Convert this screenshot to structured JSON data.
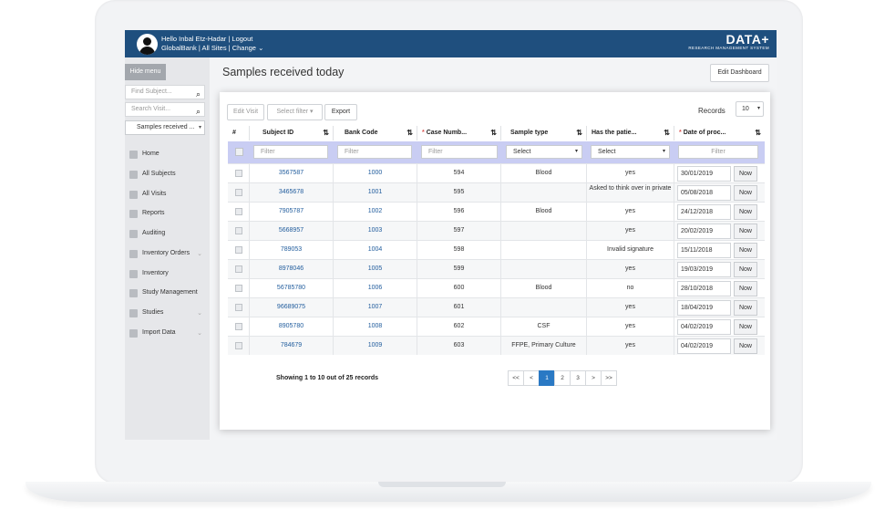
{
  "header": {
    "greeting": "Hello Inbal Etz-Hadar",
    "logout": "Logout",
    "org": "GlobalBank",
    "sites": "All Sites",
    "change": "Change",
    "brand_name": "DATA+",
    "brand_sub": "RESEARCH MANAGEMENT SYSTEM"
  },
  "sidebar": {
    "hide_menu": "Hide menu",
    "find_subject_placeholder": "Find Subject...",
    "search_visit_placeholder": "Search Visit...",
    "view_select": "Samples received ...",
    "items": [
      {
        "label": "Home",
        "icon": "home-icon"
      },
      {
        "label": "All Subjects",
        "icon": "users-icon"
      },
      {
        "label": "All Visits",
        "icon": "id-card-icon"
      },
      {
        "label": "Reports",
        "icon": "reports-icon"
      },
      {
        "label": "Auditing",
        "icon": "auditing-icon"
      },
      {
        "label": "Inventory Orders",
        "icon": "inventory-orders-icon",
        "expandable": true
      },
      {
        "label": "Inventory",
        "icon": "inventory-icon"
      },
      {
        "label": "Study Management",
        "icon": "study-management-icon"
      },
      {
        "label": "Studies",
        "icon": "studies-icon",
        "expandable": true
      },
      {
        "label": "Import Data",
        "icon": "import-icon",
        "expandable": true
      }
    ]
  },
  "main": {
    "title": "Samples received today",
    "edit_dashboard": "Edit Dashboard"
  },
  "toolbar": {
    "edit_visit": "Edit Visit",
    "select_filter": "Select filter",
    "export": "Export",
    "records_label": "Records",
    "records_value": "10"
  },
  "table": {
    "columns": [
      "#",
      "Subject ID",
      "Bank Code",
      "Case Numb...",
      "Sample type",
      "Has the patie...",
      "Date of proc..."
    ],
    "required_marker": "*",
    "filters": {
      "subject_id": "Filter",
      "bank_code": "Filter",
      "case_number": "Filter",
      "sample_type": "Select",
      "has_patient": "Select",
      "date": "Filter"
    },
    "now_label": "Now",
    "rows": [
      {
        "subject_id": "3567587",
        "bank_code": "1000",
        "case_number": "594",
        "sample_type": "Blood",
        "has_patient": "yes",
        "date": "30/01/2019"
      },
      {
        "subject_id": "3465678",
        "bank_code": "1001",
        "case_number": "595",
        "sample_type": "",
        "has_patient": "Asked to think over in private",
        "date": "05/08/2018"
      },
      {
        "subject_id": "7905787",
        "bank_code": "1002",
        "case_number": "596",
        "sample_type": "Blood",
        "has_patient": "yes",
        "date": "24/12/2018"
      },
      {
        "subject_id": "5668957",
        "bank_code": "1003",
        "case_number": "597",
        "sample_type": "",
        "has_patient": "yes",
        "date": "20/02/2019"
      },
      {
        "subject_id": "789053",
        "bank_code": "1004",
        "case_number": "598",
        "sample_type": "",
        "has_patient": "Invalid signature",
        "date": "15/11/2018"
      },
      {
        "subject_id": "8978046",
        "bank_code": "1005",
        "case_number": "599",
        "sample_type": "",
        "has_patient": "yes",
        "date": "19/03/2019"
      },
      {
        "subject_id": "56785780",
        "bank_code": "1006",
        "case_number": "600",
        "sample_type": "Blood",
        "has_patient": "no",
        "date": "28/10/2018"
      },
      {
        "subject_id": "96689075",
        "bank_code": "1007",
        "case_number": "601",
        "sample_type": "",
        "has_patient": "yes",
        "date": "18/04/2019"
      },
      {
        "subject_id": "8905780",
        "bank_code": "1008",
        "case_number": "602",
        "sample_type": "CSF",
        "has_patient": "yes",
        "date": "04/02/2019"
      },
      {
        "subject_id": "784679",
        "bank_code": "1009",
        "case_number": "603",
        "sample_type": "FFPE, Primary Culture",
        "has_patient": "yes",
        "date": "04/02/2019"
      }
    ]
  },
  "pagination": {
    "summary": "Showing 1 to 10 out of 25 records",
    "first": "<<",
    "prev": "<",
    "pages": [
      "1",
      "2",
      "3"
    ],
    "active_page": "1",
    "next": ">",
    "last": ">>"
  },
  "colors": {
    "topbar": "#1f4f7e",
    "filter_row": "#c9cdf3",
    "link": "#1f5b9c",
    "active_page": "#2a79c4"
  }
}
